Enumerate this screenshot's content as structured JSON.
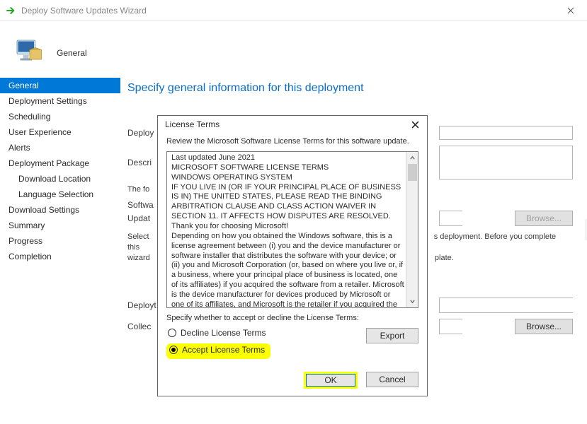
{
  "window": {
    "title": "Deploy Software Updates Wizard"
  },
  "header": {
    "page_name": "General"
  },
  "sidebar": {
    "items": [
      {
        "label": "General",
        "sub": false,
        "active": true
      },
      {
        "label": "Deployment Settings",
        "sub": false,
        "active": false
      },
      {
        "label": "Scheduling",
        "sub": false,
        "active": false
      },
      {
        "label": "User Experience",
        "sub": false,
        "active": false
      },
      {
        "label": "Alerts",
        "sub": false,
        "active": false
      },
      {
        "label": "Deployment Package",
        "sub": false,
        "active": false
      },
      {
        "label": "Download Location",
        "sub": true,
        "active": false
      },
      {
        "label": "Language Selection",
        "sub": true,
        "active": false
      },
      {
        "label": "Download Settings",
        "sub": false,
        "active": false
      },
      {
        "label": "Summary",
        "sub": false,
        "active": false
      },
      {
        "label": "Progress",
        "sub": false,
        "active": false
      },
      {
        "label": "Completion",
        "sub": false,
        "active": false
      }
    ]
  },
  "content": {
    "title": "Specify general information for this deployment",
    "labels": {
      "deploy": "Deploy",
      "descri": "Descri",
      "the_fo": "The fo",
      "softwa": "Softwa",
      "updat": "Updat",
      "select": "Select",
      "wizard": "wizard",
      "deployt": "Deployt",
      "collec": "Collec"
    },
    "long_note_tail_a": "s deployment. Before you complete this",
    "long_note_tail_b": "plate.",
    "browse": "Browse..."
  },
  "dialog": {
    "title": "License Terms",
    "instruction": "Review the Microsoft Software License Terms for this software update.",
    "eula": "Last updated June 2021\nMICROSOFT SOFTWARE LICENSE TERMS\nWINDOWS OPERATING SYSTEM\nIF YOU LIVE IN (OR IF YOUR PRINCIPAL PLACE OF BUSINESS IS IN) THE UNITED STATES, PLEASE READ THE BINDING ARBITRATION CLAUSE AND CLASS ACTION WAIVER IN SECTION 11. IT AFFECTS HOW DISPUTES ARE RESOLVED.\nThank you for choosing Microsoft!\nDepending on how you obtained the Windows software, this is a license agreement between (i) you and the device manufacturer or software installer that distributes the software with your device; or (ii) you and Microsoft Corporation (or, based on where you live or, if a business, where your principal place of business is located, one of its affiliates) if you acquired the software from a retailer. Microsoft is the device manufacturer for devices produced by Microsoft or one of its affiliates, and Microsoft is the retailer if you acquired the software directly from Microsoft. If you are a volume license customer, use of",
    "sub": "Specify whether to accept or decline the License Terms:",
    "radio_decline": "Decline License Terms",
    "radio_accept": "Accept License Terms",
    "export": "Export",
    "ok": "OK",
    "cancel": "Cancel"
  }
}
